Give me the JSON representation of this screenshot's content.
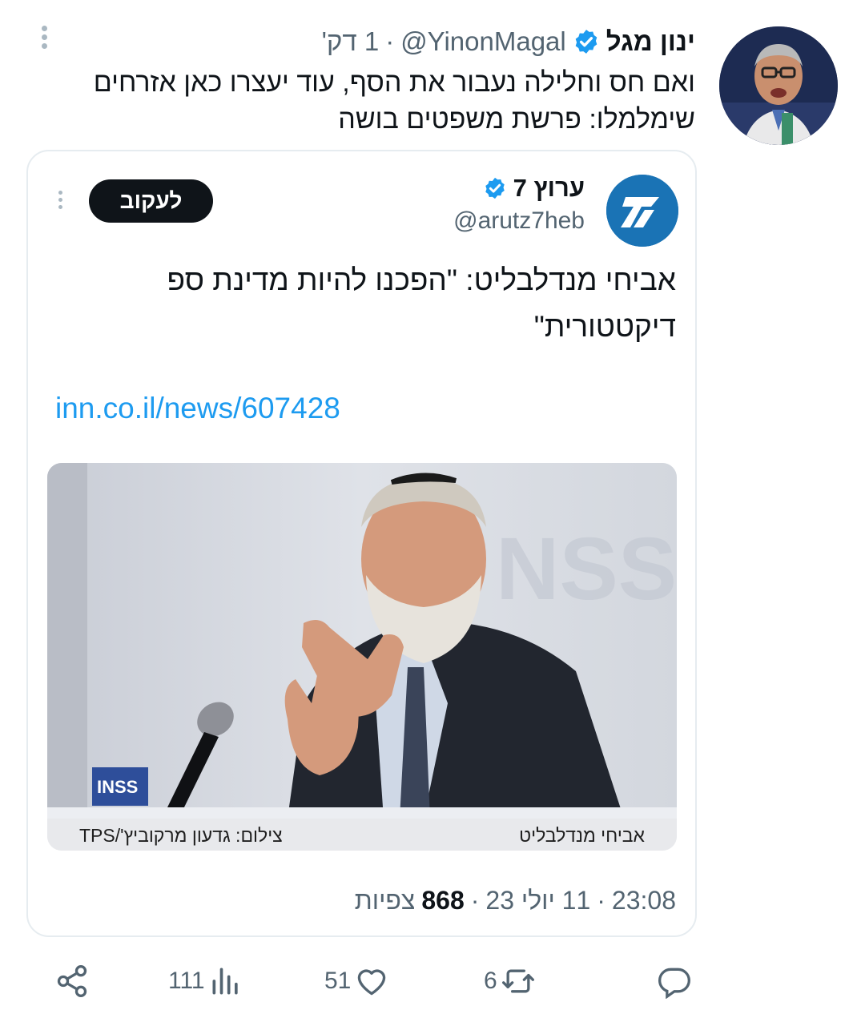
{
  "tweet": {
    "author_name": "ינון מגל",
    "handle": "@YinonMagal",
    "separator": "·",
    "time": "1 דק'",
    "text": "ואם חס וחלילה נעבור את הסף, עוד יעצרו כאן אזרחים שימלמלו: פרשת משפטים בושה"
  },
  "quoted": {
    "name": "ערוץ 7",
    "handle": "@arutz7heb",
    "follow_label": "לעקוב",
    "text": "אביחי מנדלבליט: \"הפכנו להיות מדינת ספ דיקטטורית\"",
    "link": "inn.co.il/news/607428",
    "caption_name": "אביחי מנדלבליט",
    "caption_credit": "צילום: גדעון מרקוביץ'/TPS",
    "photo_sign_text": "INSS",
    "meta_time": "23:08",
    "meta_sep1": "·",
    "meta_date": "11 יולי 23",
    "meta_sep2": "·",
    "views_count": "868",
    "views_label": "צפיות"
  },
  "actions": {
    "replies": "",
    "retweets": "6",
    "likes": "51",
    "views": "111"
  },
  "colors": {
    "text": "#0f1419",
    "secondary": "#536471",
    "link": "#1d9bf0",
    "verified": "#1d9bf0",
    "card_border": "#e6ecf0",
    "logo_blue": "#1a73b5"
  }
}
